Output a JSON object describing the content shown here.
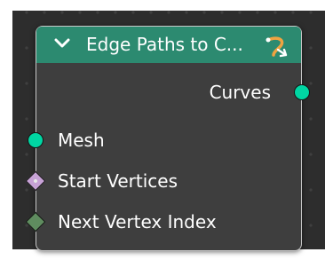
{
  "node": {
    "title": "Edge Paths to C...",
    "header_color": "#2c8a70",
    "header_icon": "chevron-down-icon",
    "type_icon": "curve-node-icon"
  },
  "outputs": [
    {
      "label": "Curves",
      "socket_shape": "circle",
      "socket_color": "#00d6a3"
    }
  ],
  "inputs": [
    {
      "label": "Mesh",
      "socket_shape": "circle",
      "socket_color": "#00d6a3"
    },
    {
      "label": "Start Vertices",
      "socket_shape": "diamond-dot",
      "socket_color": "#c7a2d6"
    },
    {
      "label": "Next Vertex Index",
      "socket_shape": "diamond",
      "socket_color": "#5f8c5f"
    }
  ]
}
